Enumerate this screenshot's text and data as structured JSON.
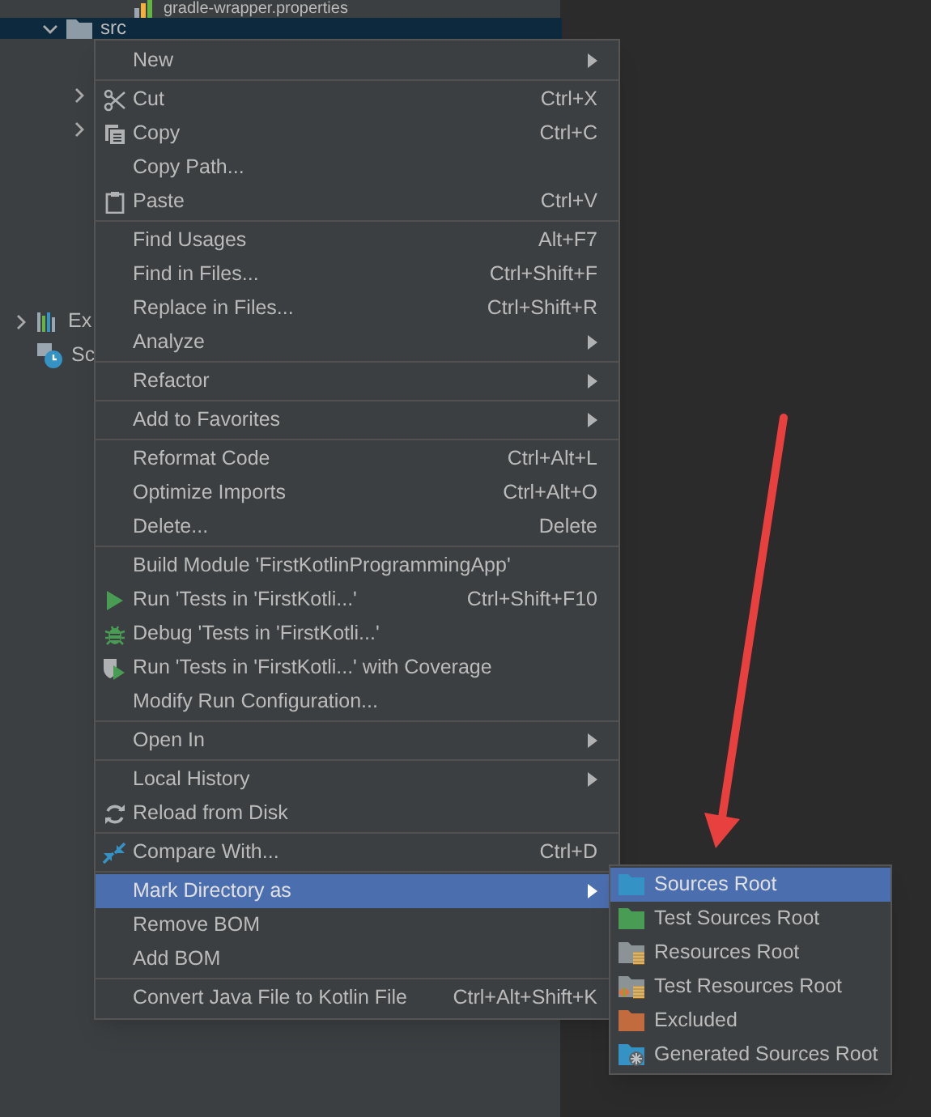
{
  "project_tree": [
    {
      "label": "gradle-wrapper.properties",
      "selected": false
    },
    {
      "label": "src",
      "expanded": true,
      "selected": true
    },
    {
      "expanded": false
    },
    {
      "expanded": false
    },
    {
      "label": "Ex",
      "expanded": false,
      "selected": false
    },
    {
      "label": "Sc",
      "selected": false
    }
  ],
  "context_menu": [
    {
      "kind": "item",
      "label": "New",
      "submenu": true
    },
    {
      "kind": "separator"
    },
    {
      "kind": "item",
      "label": "Cut",
      "shortcut": "Ctrl+X"
    },
    {
      "kind": "item",
      "label": "Copy",
      "shortcut": "Ctrl+C"
    },
    {
      "kind": "item",
      "label": "Copy Path..."
    },
    {
      "kind": "item",
      "label": "Paste",
      "shortcut": "Ctrl+V"
    },
    {
      "kind": "separator"
    },
    {
      "kind": "item",
      "label": "Find Usages",
      "shortcut": "Alt+F7"
    },
    {
      "kind": "item",
      "label": "Find in Files...",
      "shortcut": "Ctrl+Shift+F"
    },
    {
      "kind": "item",
      "label": "Replace in Files...",
      "shortcut": "Ctrl+Shift+R"
    },
    {
      "kind": "item",
      "label": "Analyze",
      "submenu": true
    },
    {
      "kind": "separator"
    },
    {
      "kind": "item",
      "label": "Refactor",
      "submenu": true
    },
    {
      "kind": "separator"
    },
    {
      "kind": "item",
      "label": "Add to Favorites",
      "submenu": true
    },
    {
      "kind": "separator"
    },
    {
      "kind": "item",
      "label": "Reformat Code",
      "shortcut": "Ctrl+Alt+L"
    },
    {
      "kind": "item",
      "label": "Optimize Imports",
      "shortcut": "Ctrl+Alt+O"
    },
    {
      "kind": "item",
      "label": "Delete...",
      "shortcut": "Delete"
    },
    {
      "kind": "separator"
    },
    {
      "kind": "item",
      "label": "Build Module 'FirstKotlinProgrammingApp'"
    },
    {
      "kind": "item",
      "label": "Run 'Tests in 'FirstKotli...'",
      "shortcut": "Ctrl+Shift+F10"
    },
    {
      "kind": "item",
      "label": "Debug 'Tests in 'FirstKotli...'"
    },
    {
      "kind": "item",
      "label": "Run 'Tests in 'FirstKotli...' with Coverage"
    },
    {
      "kind": "item",
      "label": "Modify Run Configuration..."
    },
    {
      "kind": "separator"
    },
    {
      "kind": "item",
      "label": "Open In",
      "submenu": true
    },
    {
      "kind": "separator"
    },
    {
      "kind": "item",
      "label": "Local History",
      "submenu": true
    },
    {
      "kind": "item",
      "label": "Reload from Disk"
    },
    {
      "kind": "separator"
    },
    {
      "kind": "item",
      "label": "Compare With...",
      "shortcut": "Ctrl+D"
    },
    {
      "kind": "separator"
    },
    {
      "kind": "item",
      "label": "Mark Directory as",
      "submenu": true,
      "selected": true
    },
    {
      "kind": "item",
      "label": "Remove BOM"
    },
    {
      "kind": "item",
      "label": "Add BOM"
    },
    {
      "kind": "separator"
    },
    {
      "kind": "item",
      "label": "Convert Java File to Kotlin File",
      "shortcut": "Ctrl+Alt+Shift+K"
    }
  ],
  "mark_directory_submenu": [
    {
      "label": "Sources Root",
      "color": "#3592c4",
      "selected": true
    },
    {
      "label": "Test Sources Root",
      "color": "#499c54",
      "selected": false
    },
    {
      "label": "Resources Root",
      "color": "#8c9396",
      "selected": false
    },
    {
      "label": "Test Resources Root",
      "color": "#8c9396",
      "selected": false
    },
    {
      "label": "Excluded",
      "color": "#c26b3f",
      "selected": false
    },
    {
      "label": "Generated Sources Root",
      "color": "#3592c4",
      "selected": false
    }
  ]
}
